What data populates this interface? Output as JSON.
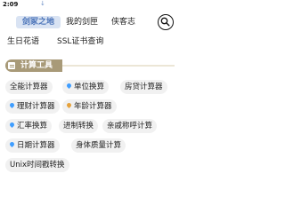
{
  "status_bar": {
    "time": "2:09"
  },
  "topnav": {
    "tabs": [
      {
        "label": "剑冢之地",
        "active": true
      },
      {
        "label": "我的剑匣",
        "active": false
      },
      {
        "label": "侠客志",
        "active": false
      }
    ],
    "search_icon": "search-icon"
  },
  "quick_links": [
    {
      "label": "生日花语"
    },
    {
      "label": "SSL证书查询"
    }
  ],
  "section": {
    "title": "计算工具",
    "icon": "list-icon"
  },
  "tools": [
    {
      "label": "全能计算器",
      "pin": null
    },
    {
      "label": "单位换算",
      "pin": "blue"
    },
    {
      "label": "房贷计算器",
      "pin": null
    },
    {
      "label": "理财计算器",
      "pin": "blue"
    },
    {
      "label": "年龄计算器",
      "pin": "orange"
    },
    {
      "label": "汇率换算",
      "pin": "blue"
    },
    {
      "label": "进制转换",
      "pin": null
    },
    {
      "label": "亲戚称呼计算",
      "pin": null
    },
    {
      "label": "日期计算器",
      "pin": "blue"
    },
    {
      "label": "身体质量计算",
      "pin": null
    },
    {
      "label": "Unix时间戳转换",
      "pin": null
    }
  ]
}
